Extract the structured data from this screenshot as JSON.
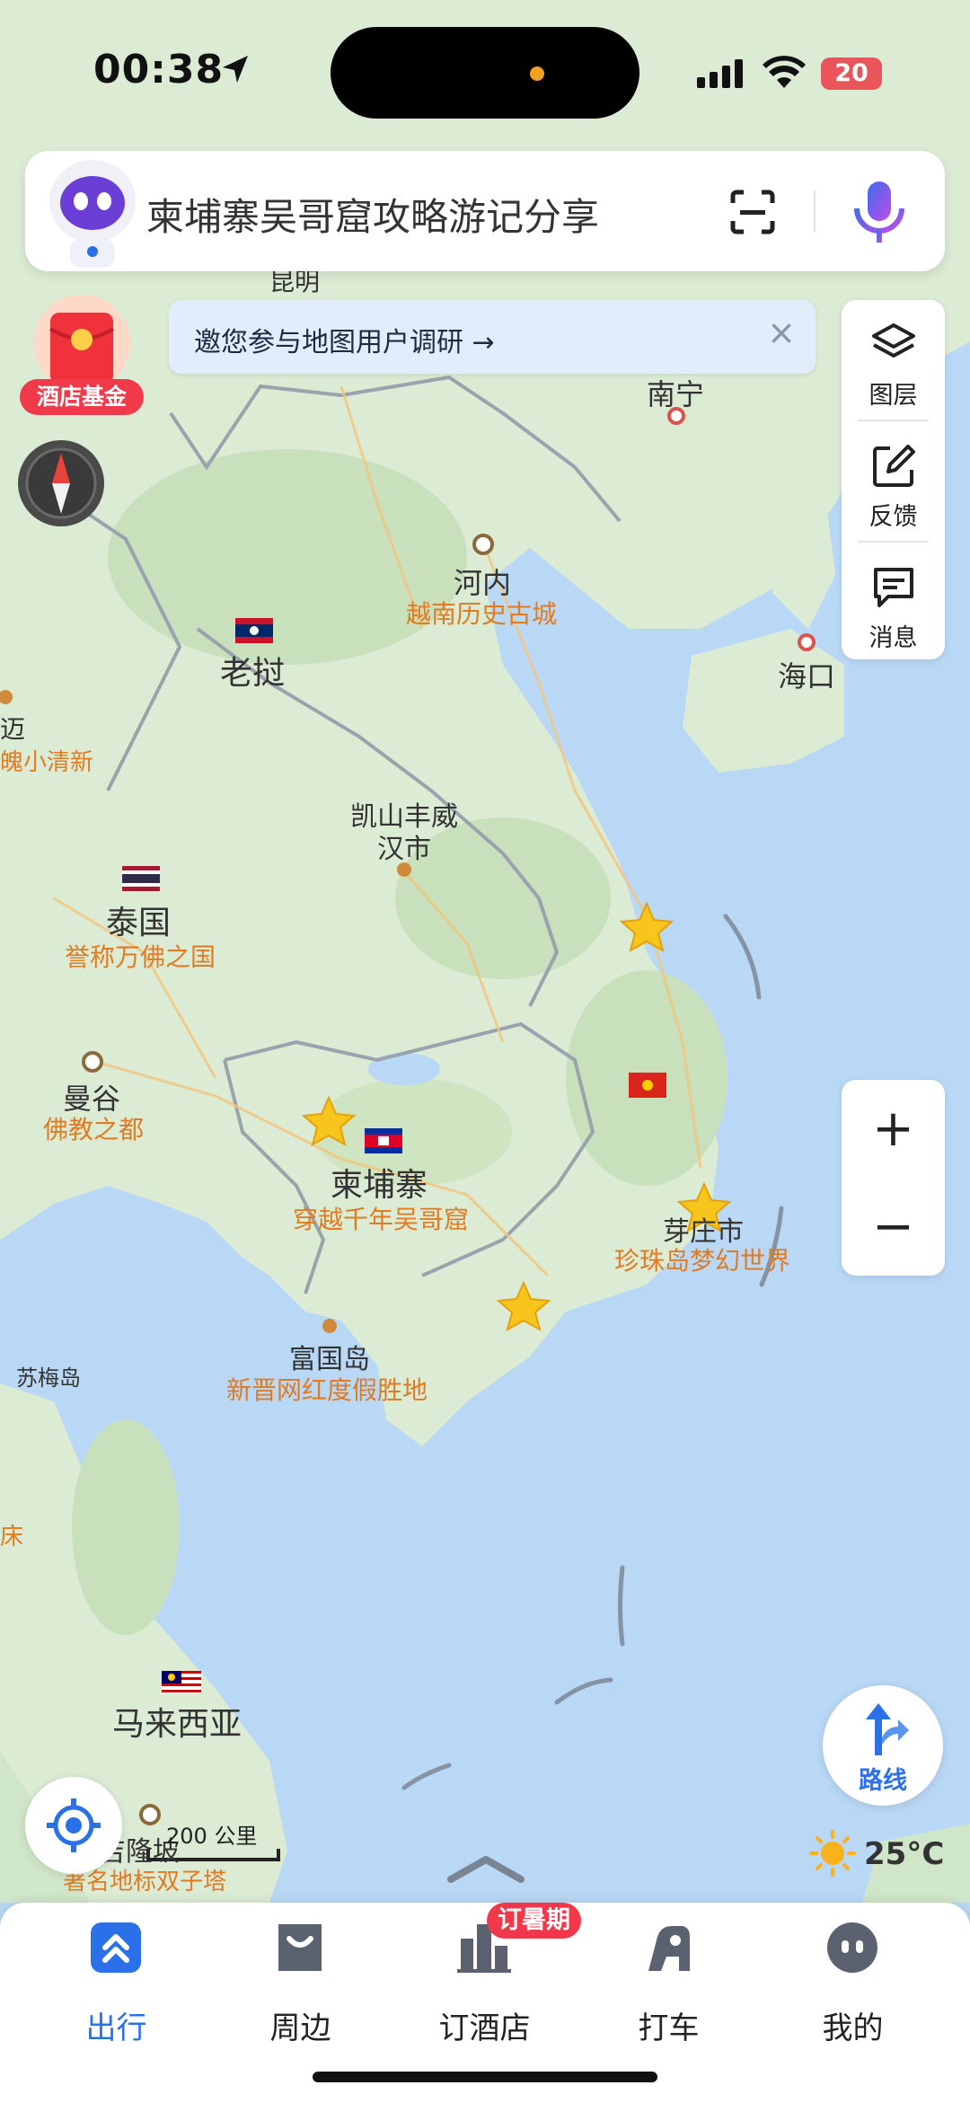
{
  "status_bar": {
    "time": "00:38",
    "battery": "20"
  },
  "search": {
    "placeholder": "柬埔寨吴哥窟攻略游记分享"
  },
  "survey_banner": {
    "text": "邀您参与地图用户调研 →",
    "close": "×"
  },
  "hotel_fund": {
    "label": "酒店基金"
  },
  "side_controls": {
    "layers": "图层",
    "feedback": "反馈",
    "messages": "消息"
  },
  "zoom": {
    "in": "+",
    "out": "−"
  },
  "route_button": {
    "label": "路线"
  },
  "weather": {
    "temp": "25°C"
  },
  "scale": {
    "label": "200 公里"
  },
  "map_labels": {
    "kunming": "昆明",
    "nanning": "南宁",
    "hanoi": "河内",
    "hanoi_sub": "越南历史古城",
    "haikou": "海口",
    "laos": "老挝",
    "chiangmai_fragment": "迈",
    "chiangmai_sub_fragment": "魄小清新",
    "savannakhet_line1": "凯山丰威",
    "savannakhet_line2": "汉市",
    "thailand": "泰国",
    "thailand_sub": "誉称万佛之国",
    "bangkok": "曼谷",
    "bangkok_sub": "佛教之都",
    "cambodia": "柬埔寨",
    "cambodia_sub": "穿越千年吴哥窟",
    "nhatrang": "芽庄市",
    "nhatrang_sub": "珍珠岛梦幻世界",
    "phuquoc": "富国岛",
    "phuquoc_sub": "新晋网红度假胜地",
    "sumei": "苏梅岛",
    "malaysia": "马来西亚",
    "kualalumpur": "吉隆坡",
    "kualalumpur_sub": "著名地标双子塔",
    "left_fragment": "床"
  },
  "tabs": [
    {
      "label": "出行",
      "active": true
    },
    {
      "label": "周边"
    },
    {
      "label": "订酒店"
    },
    {
      "label": "打车"
    },
    {
      "label": "我的"
    }
  ],
  "tab_badge": "订暑期",
  "colors": {
    "accent": "#2a70e8",
    "city_orange": "#e07b22",
    "sea": "#b9d8f6",
    "land": "#dcebd4"
  }
}
